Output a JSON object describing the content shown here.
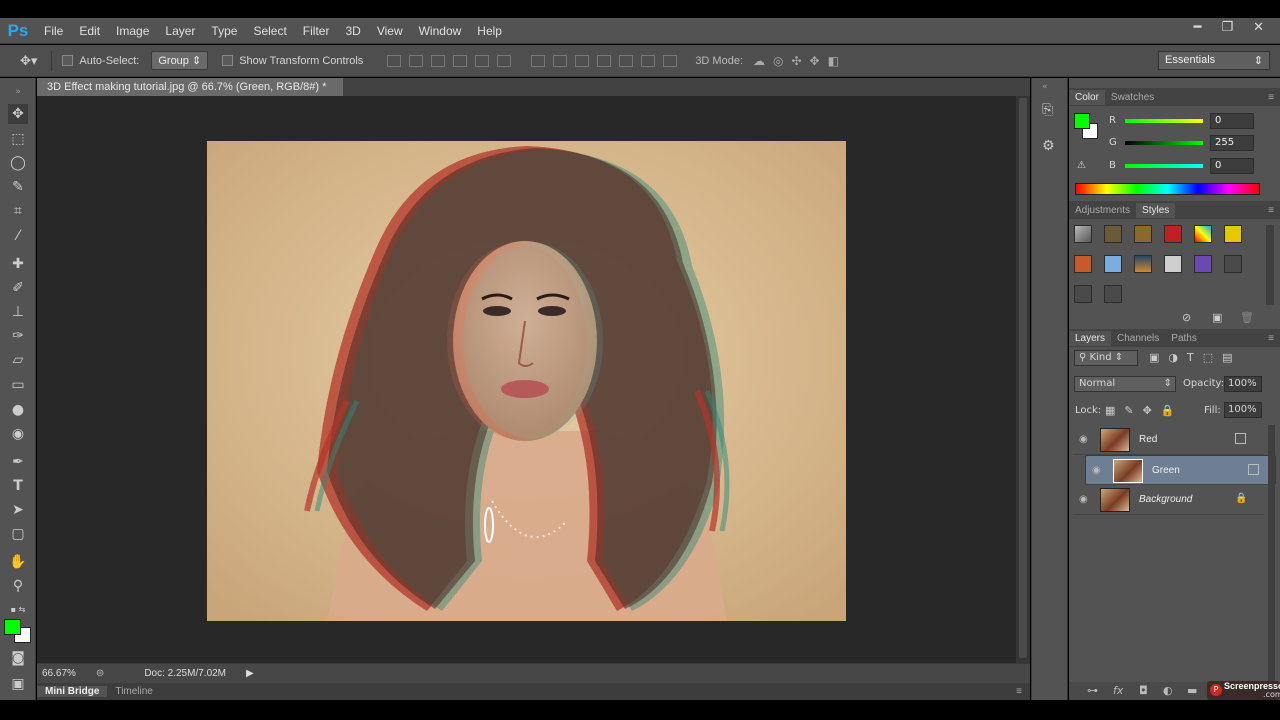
{
  "app": {
    "logo": "Ps"
  },
  "menu": [
    "File",
    "Edit",
    "Image",
    "Layer",
    "Type",
    "Select",
    "Filter",
    "3D",
    "View",
    "Window",
    "Help"
  ],
  "window_controls": {
    "minimize": "━",
    "restore": "❐",
    "close": "✕"
  },
  "options": {
    "auto_select_label": "Auto-Select:",
    "auto_select_value": "Group",
    "show_transform_label": "Show Transform Controls",
    "mode_3d_label": "3D Mode:",
    "workspace": "Essentials"
  },
  "document": {
    "tab_title": "3D Effect making tutorial.jpg @ 66.7% (Green, RGB/8#) *",
    "tab_close": "×",
    "zoom": "66.67%",
    "doc_size": "Doc: 2.25M/7.02M"
  },
  "bottom_tabs": [
    "Mini Bridge",
    "Timeline"
  ],
  "color_panel": {
    "tabs": [
      "Color",
      "Swatches"
    ],
    "foreground": "#00ff00",
    "channels": [
      {
        "label": "R",
        "value": "0"
      },
      {
        "label": "G",
        "value": "255"
      },
      {
        "label": "B",
        "value": "0"
      }
    ]
  },
  "styles_panel": {
    "tabs": [
      "Adjustments",
      "Styles"
    ]
  },
  "layers_panel": {
    "tabs": [
      "Layers",
      "Channels",
      "Paths"
    ],
    "kind_label": "Kind",
    "blend_mode": "Normal",
    "opacity_label": "Opacity:",
    "opacity_value": "100%",
    "lock_label": "Lock:",
    "fill_label": "Fill:",
    "fill_value": "100%",
    "layers": [
      {
        "name": "Red",
        "selected": false
      },
      {
        "name": "Green",
        "selected": true
      },
      {
        "name": "Background",
        "selected": false
      }
    ]
  },
  "watermark": {
    "brand": "Screenpresso",
    "sub": ".com"
  }
}
